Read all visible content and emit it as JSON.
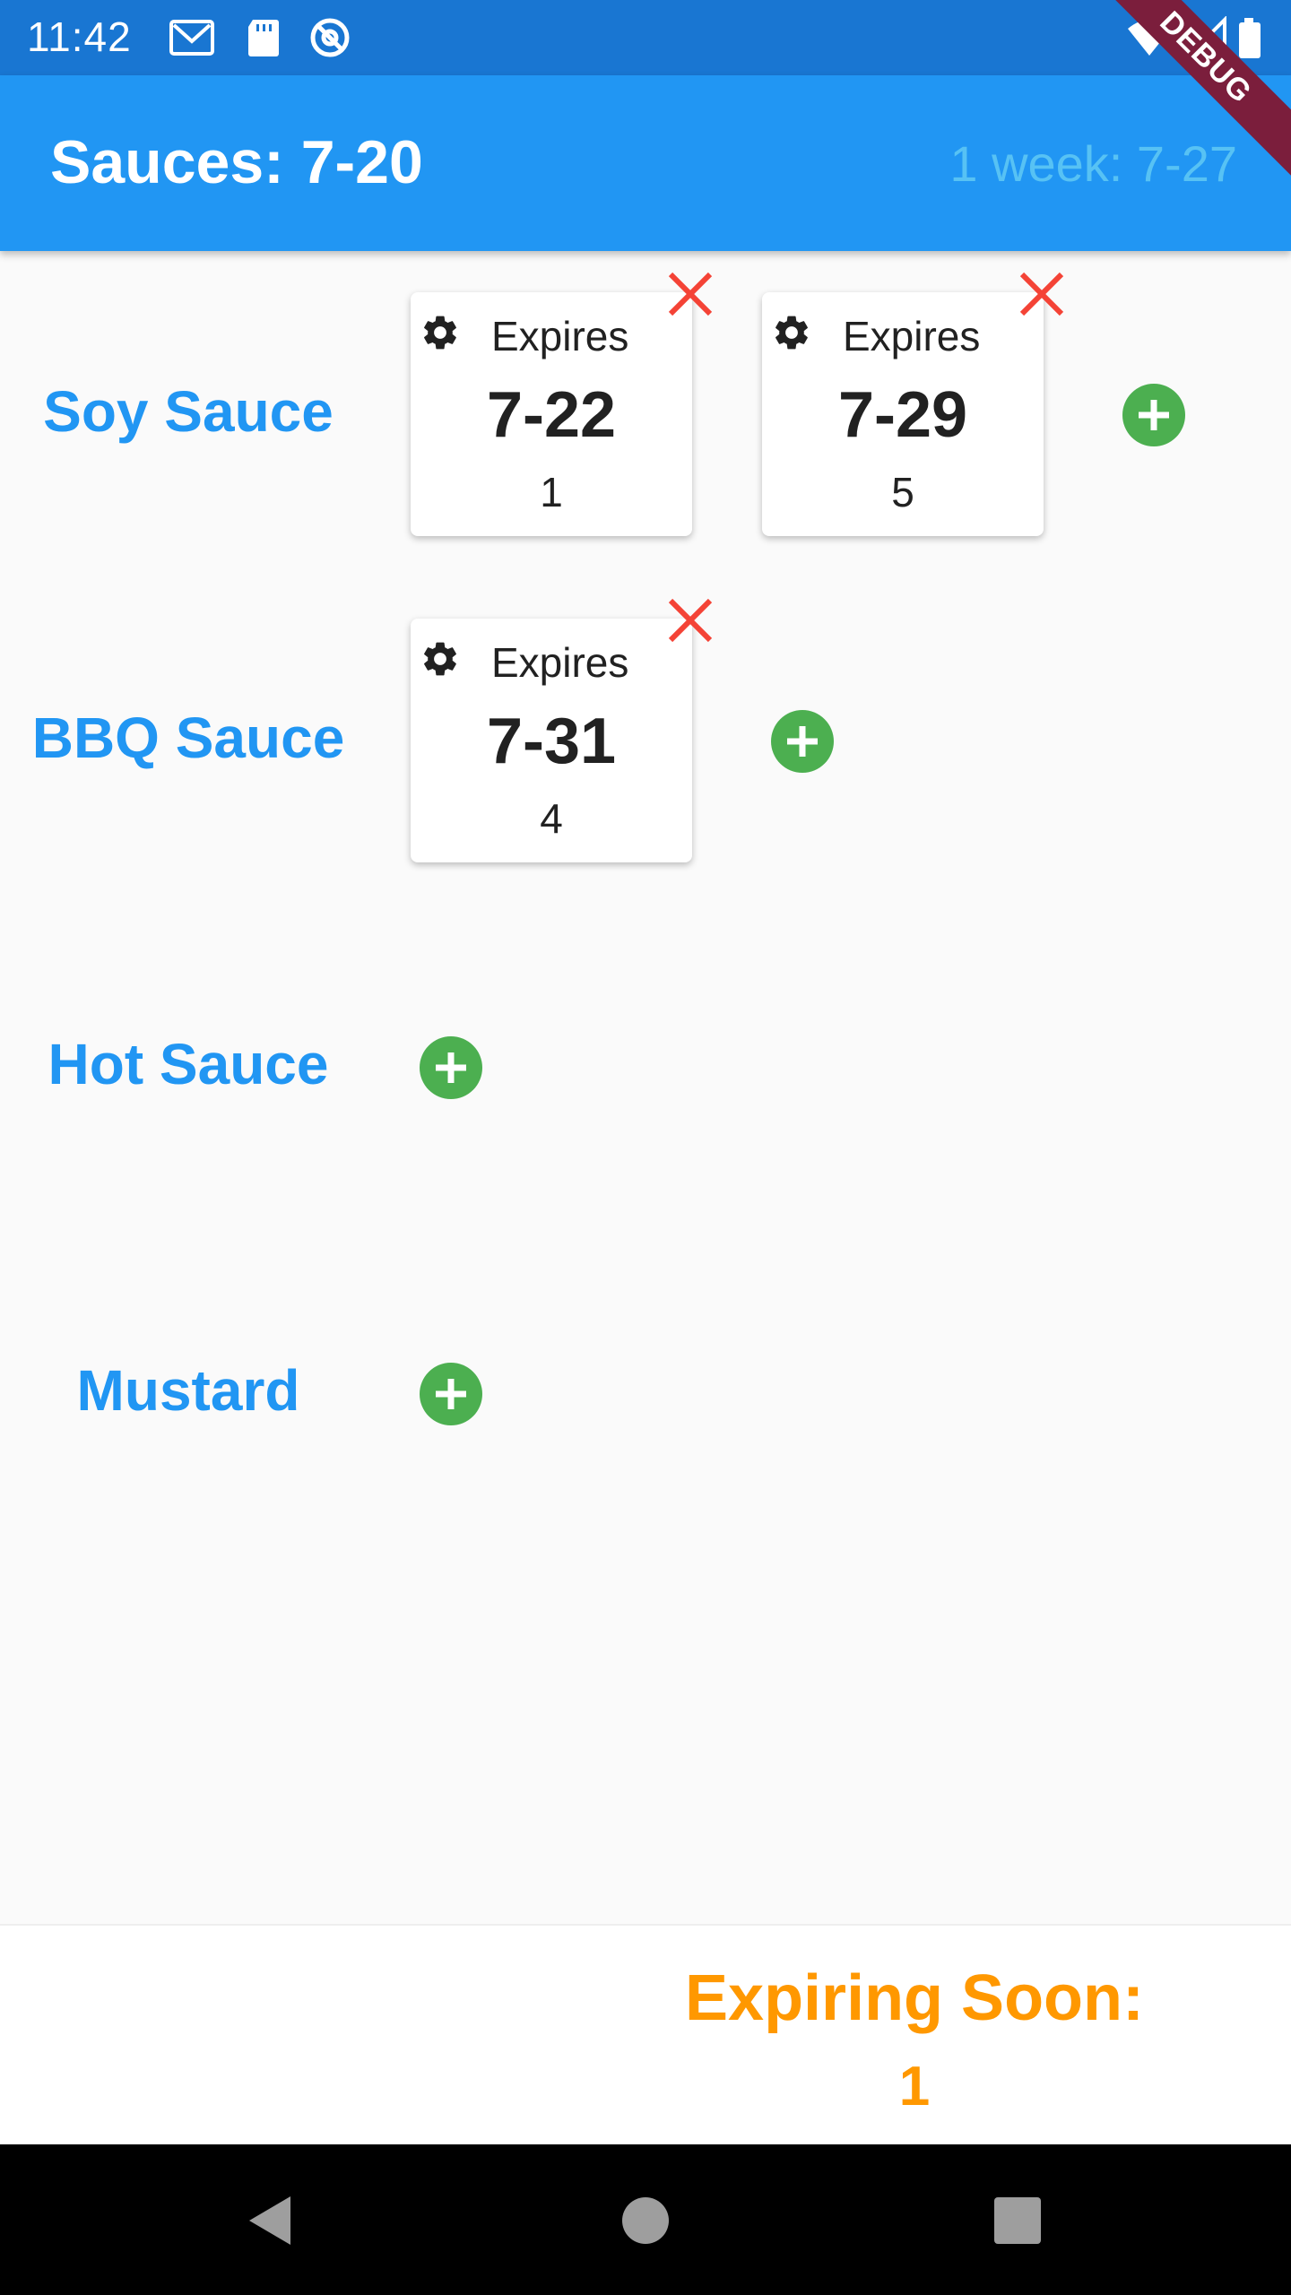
{
  "status_bar": {
    "time": "11:42",
    "left_icons": [
      "gmail-icon",
      "sd-card-icon",
      "at-sign-icon"
    ],
    "right_icons": [
      "wifi-icon",
      "signal-icon",
      "battery-icon"
    ]
  },
  "debug_banner": "DEBUG",
  "app_bar": {
    "title": "Sauces: 7-20",
    "week": "1 week: 7-27",
    "color": "#2196f3"
  },
  "rows": [
    {
      "label": "Soy Sauce",
      "items": [
        {
          "expires_label": "Expires",
          "date": "7-22",
          "count": "1"
        },
        {
          "expires_label": "Expires",
          "date": "7-29",
          "count": "5"
        }
      ]
    },
    {
      "label": "BBQ Sauce",
      "items": [
        {
          "expires_label": "Expires",
          "date": "7-31",
          "count": "4"
        }
      ]
    },
    {
      "label": "Hot Sauce",
      "items": []
    },
    {
      "label": "Mustard",
      "items": []
    }
  ],
  "footer": {
    "label": "Expiring Soon:",
    "count": "1",
    "color": "#ff9800"
  },
  "colors": {
    "label": "#2196f3",
    "add": "#4caf50",
    "delete": "#f44336"
  }
}
